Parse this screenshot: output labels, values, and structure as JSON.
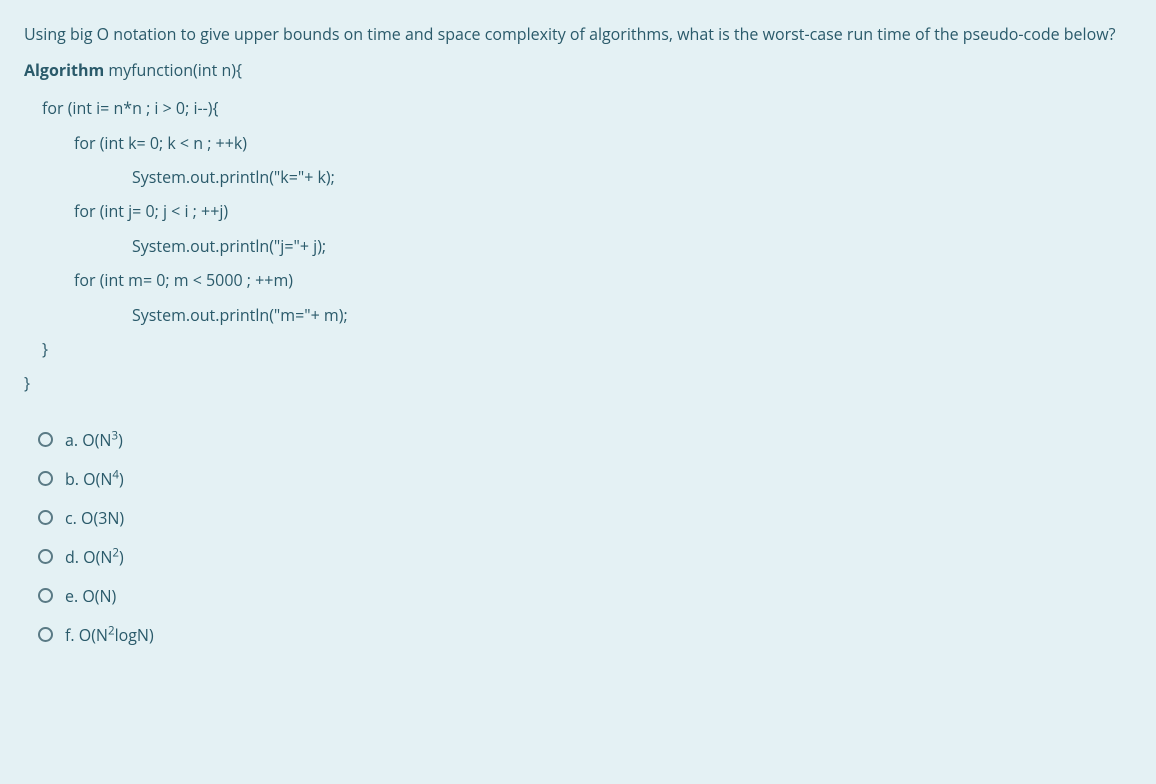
{
  "question": {
    "text": "Using big O notation to give upper bounds on time and space complexity of algorithms, what is the worst-case run time of the pseudo-code below?"
  },
  "algorithm": {
    "keyword": "Algorithm",
    "signature": "  myfunction(int n){",
    "lines": {
      "l1": "for (int i= n*n ; i > 0; i--){",
      "l2": "for (int k= 0; k < n ; ++k)",
      "l3": "System.out.println(\"k=\"+ k);",
      "l4": "for (int j= 0; j < i ; ++j)",
      "l5": "System.out.println(\"j=\"+ j);",
      "l6": "for (int m= 0; m < 5000 ; ++m)",
      "l7": "System.out.println(\"m=\"+ m);",
      "l8": "}",
      "l9": "}"
    }
  },
  "options": {
    "a": {
      "letter": "a.",
      "text": "O(N",
      "sup": "3",
      "tail": ")"
    },
    "b": {
      "letter": "b.",
      "text": "O(N",
      "sup": "4",
      "tail": ")"
    },
    "c": {
      "letter": "c.",
      "text": "O(3N)",
      "sup": "",
      "tail": ""
    },
    "d": {
      "letter": "d.",
      "text": "O(N",
      "sup": "2",
      "tail": ")"
    },
    "e": {
      "letter": "e.",
      "text": "O(N)",
      "sup": "",
      "tail": ""
    },
    "f": {
      "letter": "f.",
      "text": "O(N",
      "sup": "2",
      "tail": "logN)"
    }
  }
}
